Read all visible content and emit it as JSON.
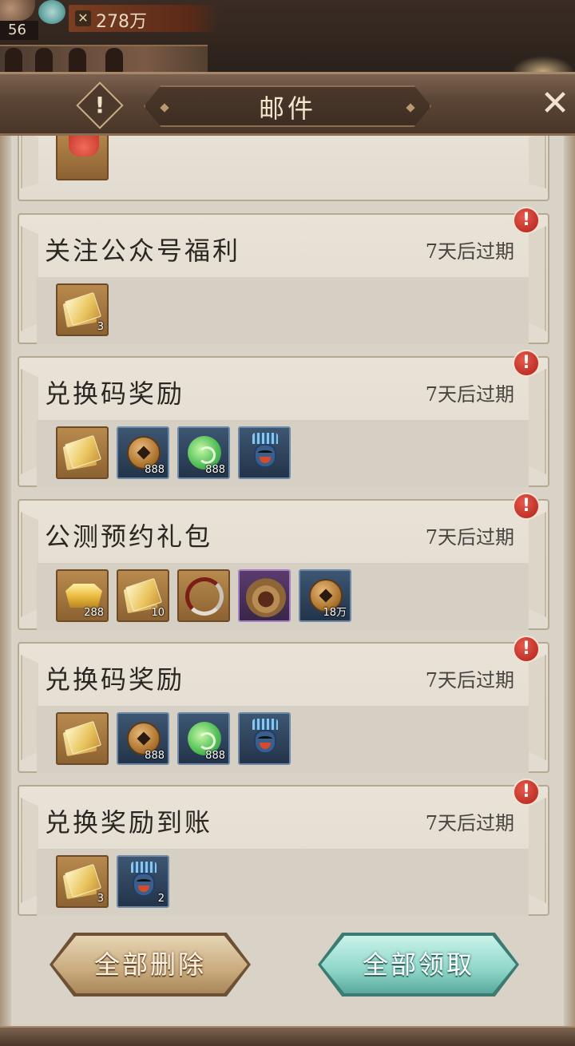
{
  "status": {
    "level": "56",
    "power_value": "278万"
  },
  "dialog": {
    "title": "邮件",
    "info_glyph": "!",
    "close_glyph": "✕"
  },
  "mails": [
    {
      "title": "",
      "expire": "",
      "items": [
        {
          "icon": "red-pouch-icon",
          "frame": "gold",
          "qty": ""
        }
      ]
    },
    {
      "title": "关注公众号福利",
      "expire": "7天后过期",
      "unread": true,
      "items": [
        {
          "icon": "ticket-icon",
          "frame": "gold",
          "qty": "3"
        }
      ]
    },
    {
      "title": "兑换码奖励",
      "expire": "7天后过期",
      "unread": true,
      "items": [
        {
          "icon": "ticket-icon",
          "frame": "gold",
          "qty": ""
        },
        {
          "icon": "copper-coin-icon",
          "frame": "blue",
          "qty": "888"
        },
        {
          "icon": "jade-orb-icon",
          "frame": "blue",
          "qty": "888"
        },
        {
          "icon": "blue-doll-icon",
          "frame": "blue",
          "qty": ""
        }
      ]
    },
    {
      "title": "公测预约礼包",
      "expire": "7天后过期",
      "unread": true,
      "items": [
        {
          "icon": "gold-ingot-icon",
          "frame": "gold",
          "qty": "288"
        },
        {
          "icon": "ticket-icon",
          "frame": "gold",
          "qty": "10"
        },
        {
          "icon": "ring-icon",
          "frame": "gold",
          "qty": ""
        },
        {
          "icon": "lion-head-icon",
          "frame": "purple",
          "qty": ""
        },
        {
          "icon": "copper-coin-icon",
          "frame": "blue",
          "qty": "18万"
        }
      ]
    },
    {
      "title": "兑换码奖励",
      "expire": "7天后过期",
      "unread": true,
      "items": [
        {
          "icon": "ticket-icon",
          "frame": "gold",
          "qty": ""
        },
        {
          "icon": "copper-coin-icon",
          "frame": "blue",
          "qty": "888"
        },
        {
          "icon": "jade-orb-icon",
          "frame": "blue",
          "qty": "888"
        },
        {
          "icon": "blue-doll-icon",
          "frame": "blue",
          "qty": ""
        }
      ]
    },
    {
      "title": "兑换奖励到账",
      "expire": "7天后过期",
      "unread": true,
      "items": [
        {
          "icon": "ticket-icon",
          "frame": "gold",
          "qty": "3"
        },
        {
          "icon": "blue-doll-icon",
          "frame": "blue",
          "qty": "2"
        }
      ]
    }
  ],
  "actions": {
    "delete_all": "全部删除",
    "claim_all": "全部领取"
  },
  "colors": {
    "alert_red": "#c4281f",
    "claim_teal": "#8ed6c8",
    "delete_tan": "#c9ab7e"
  }
}
